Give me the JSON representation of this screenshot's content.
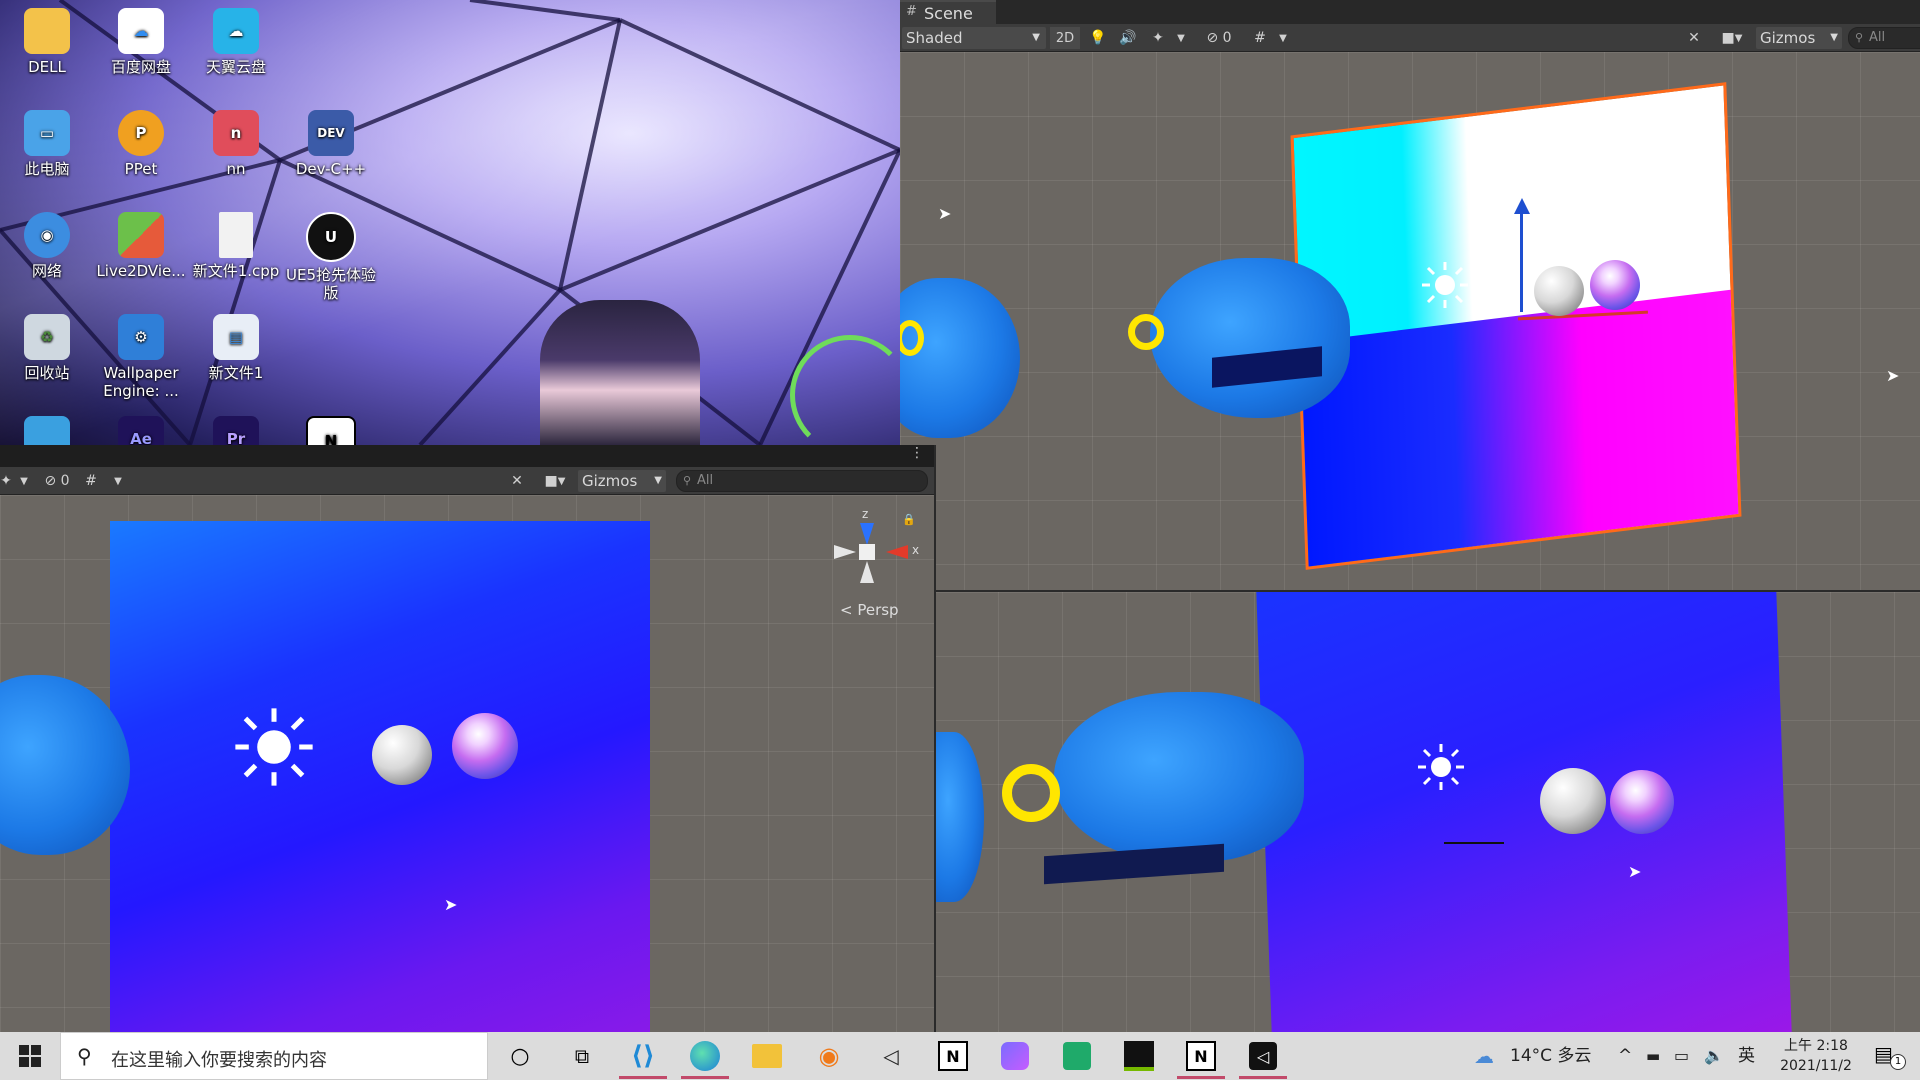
{
  "desktop": {
    "icons": [
      {
        "label": "DELL",
        "icon": "folder-icon",
        "color": "#f3c24a"
      },
      {
        "label": "百度网盘",
        "icon": "baidu-cloud-icon",
        "color": "#2f8cf0"
      },
      {
        "label": "天翼云盘",
        "icon": "tianyi-cloud-icon",
        "color": "#27b3e8"
      },
      {
        "label": "此电脑",
        "icon": "computer-icon",
        "color": "#4aa3e8"
      },
      {
        "label": "PPet",
        "icon": "ppet-icon",
        "color": "#f0a020"
      },
      {
        "label": "nn",
        "icon": "nn-icon",
        "color": "#e04d5b"
      },
      {
        "label": "Dev-C++",
        "icon": "devcpp-icon",
        "color": "#3b5ba8"
      },
      {
        "label": "网络",
        "icon": "network-icon",
        "color": "#3c8de0"
      },
      {
        "label": "Live2DVie...",
        "icon": "live2d-icon",
        "color": "#6cc04a"
      },
      {
        "label": "新文件1.cpp",
        "icon": "file-icon",
        "color": "#f2f2f2"
      },
      {
        "label": "UE5抢先体验版",
        "icon": "unreal-icon",
        "color": "#111111"
      },
      {
        "label": "回收站",
        "icon": "recycle-bin-icon",
        "color": "#cfd8e0"
      },
      {
        "label": "Wallpaper Engine: ...",
        "icon": "wallpaper-engine-icon",
        "color": "#2f7fd8"
      },
      {
        "label": "新文件1",
        "icon": "document-icon",
        "color": "#3a86d6"
      },
      {
        "label": "",
        "icon": "control-panel-icon",
        "color": "#3aa0e0"
      },
      {
        "label": "Ae",
        "icon": "after-effects-icon",
        "color": "#1f1259"
      },
      {
        "label": "Pr",
        "icon": "premiere-icon",
        "color": "#1f1259"
      },
      {
        "label": "N",
        "icon": "notion-icon",
        "color": "#ffffff"
      }
    ]
  },
  "scene_window": {
    "tab_label": "Scene",
    "shading_mode": "Shaded",
    "mode_2d": "2D",
    "hidden_count": "0",
    "gizmos_label": "Gizmos",
    "search_placeholder": "All"
  },
  "persp_view": {
    "hidden_count": "0",
    "gizmos_label": "Gizmos",
    "search_placeholder": "All",
    "axis_z": "z",
    "axis_x": "x",
    "persp_label": "< Persp"
  },
  "taskbar": {
    "search_placeholder": "在这里输入你要搜索的内容",
    "apps": [
      {
        "icon": "cortana-icon",
        "active": false
      },
      {
        "icon": "task-view-icon",
        "active": false
      },
      {
        "icon": "vscode-icon",
        "active": true
      },
      {
        "icon": "edge-icon",
        "active": true
      },
      {
        "icon": "file-explorer-icon",
        "active": false
      },
      {
        "icon": "blender-icon",
        "active": false
      },
      {
        "icon": "unity-hub-icon",
        "active": false
      },
      {
        "icon": "notion-icon",
        "active": false
      },
      {
        "icon": "chat-app-icon",
        "active": false
      },
      {
        "icon": "image-viewer-icon",
        "active": false
      },
      {
        "icon": "nvidia-icon",
        "active": false
      },
      {
        "icon": "notion-icon",
        "active": true
      },
      {
        "icon": "unity-icon",
        "active": true
      }
    ],
    "weather": "14°C 多云",
    "ime": "英",
    "time": "上午 2:18",
    "date": "2021/11/2",
    "notification_count": "1"
  }
}
